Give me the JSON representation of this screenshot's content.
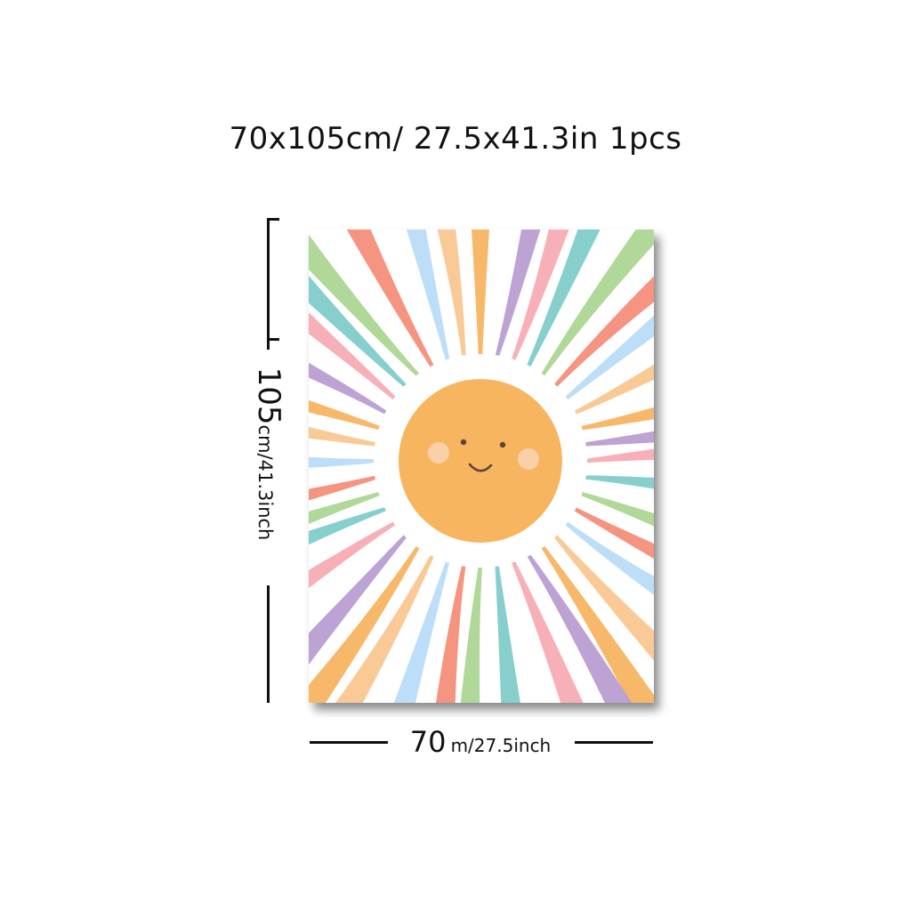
{
  "header": {
    "size_text": "70x105cm/ 27.5x41.3in",
    "quantity": "1pcs"
  },
  "dimensions": {
    "height_value": "105",
    "height_unit": "cm/41.3inch",
    "width_value": "70",
    "width_unit": "m/27.5inch"
  },
  "poster": {
    "subject": "smiling-sun-icon",
    "sun_color": "#f7b560",
    "cheek_color": "#fbd3b4",
    "ray_colors": [
      "#f7b25c",
      "#b79ad0",
      "#f6a9b1",
      "#7ccbc9",
      "#a9d58f",
      "#f48b76",
      "#b7dbf7",
      "#f9c68c"
    ]
  }
}
